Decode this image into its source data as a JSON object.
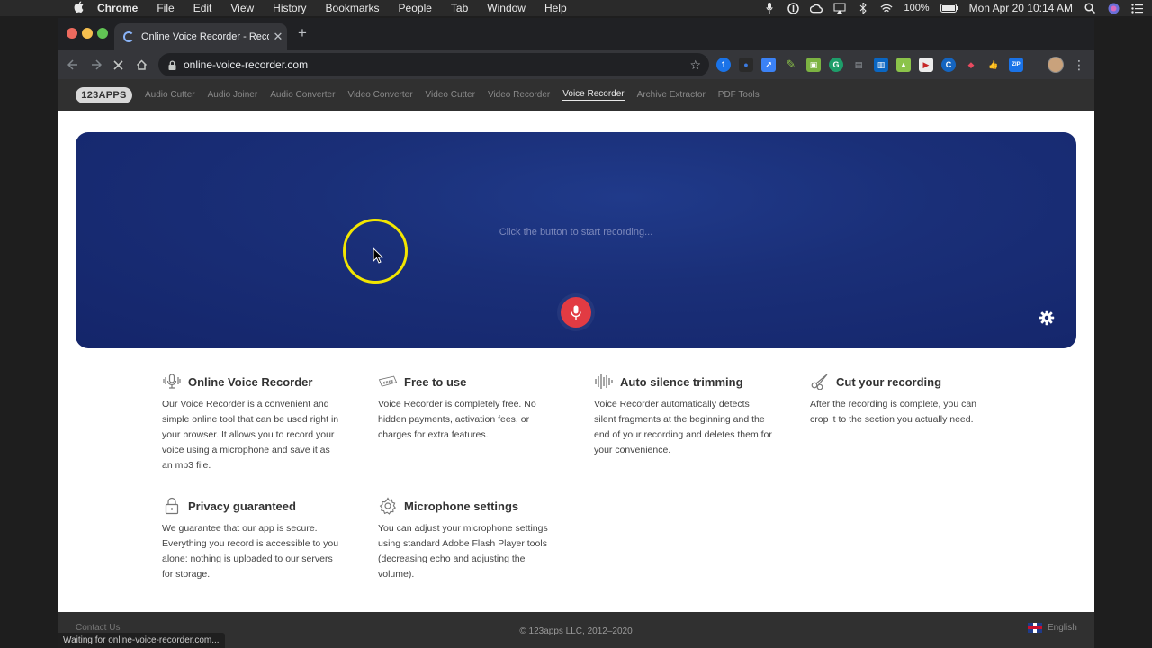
{
  "menubar": {
    "app": "Chrome",
    "items": [
      "File",
      "Edit",
      "View",
      "History",
      "Bookmarks",
      "People",
      "Tab",
      "Window",
      "Help"
    ],
    "battery": "100%",
    "clock": "Mon Apr 20  10:14 AM"
  },
  "browser": {
    "tab_title": "Online Voice Recorder - Recor",
    "url": "online-voice-recorder.com",
    "status": "Waiting for online-voice-recorder.com..."
  },
  "site": {
    "logo": "123APPS",
    "nav": [
      "Audio Cutter",
      "Audio Joiner",
      "Audio Converter",
      "Video Converter",
      "Video Cutter",
      "Video Recorder",
      "Voice Recorder",
      "Archive Extractor",
      "PDF Tools"
    ],
    "active_nav": "Voice Recorder"
  },
  "recorder": {
    "hint": "Click the button to start recording..."
  },
  "features": [
    {
      "title": "Online Voice Recorder",
      "icon": "mic-waves-icon",
      "desc": "Our Voice Recorder is a convenient and simple online tool that can be used right in your browser. It allows you to record your voice using a microphone and save it as an mp3 file."
    },
    {
      "title": "Free to use",
      "icon": "free-tag-icon",
      "desc": "Voice Recorder is completely free. No hidden payments, activation fees, or charges for extra features."
    },
    {
      "title": "Auto silence trimming",
      "icon": "waveform-icon",
      "desc": "Voice Recorder automatically detects silent fragments at the beginning and the end of your recording and deletes them for your convenience."
    },
    {
      "title": "Cut your recording",
      "icon": "scissors-icon",
      "desc": "After the recording is complete, you can crop it to the section you actually need."
    },
    {
      "title": "Privacy guaranteed",
      "icon": "lock-icon",
      "desc": "We guarantee that our app is secure. Everything you record is accessible to you alone: nothing is uploaded to our servers for storage."
    },
    {
      "title": "Microphone settings",
      "icon": "gear-icon",
      "desc": "You can adjust your microphone settings using standard Adobe Flash Player tools (decreasing echo and adjusting the volume)."
    }
  ],
  "footer": {
    "contact": "Contact Us",
    "copyright": "© 123apps LLC, 2012–2020",
    "language": "English"
  }
}
